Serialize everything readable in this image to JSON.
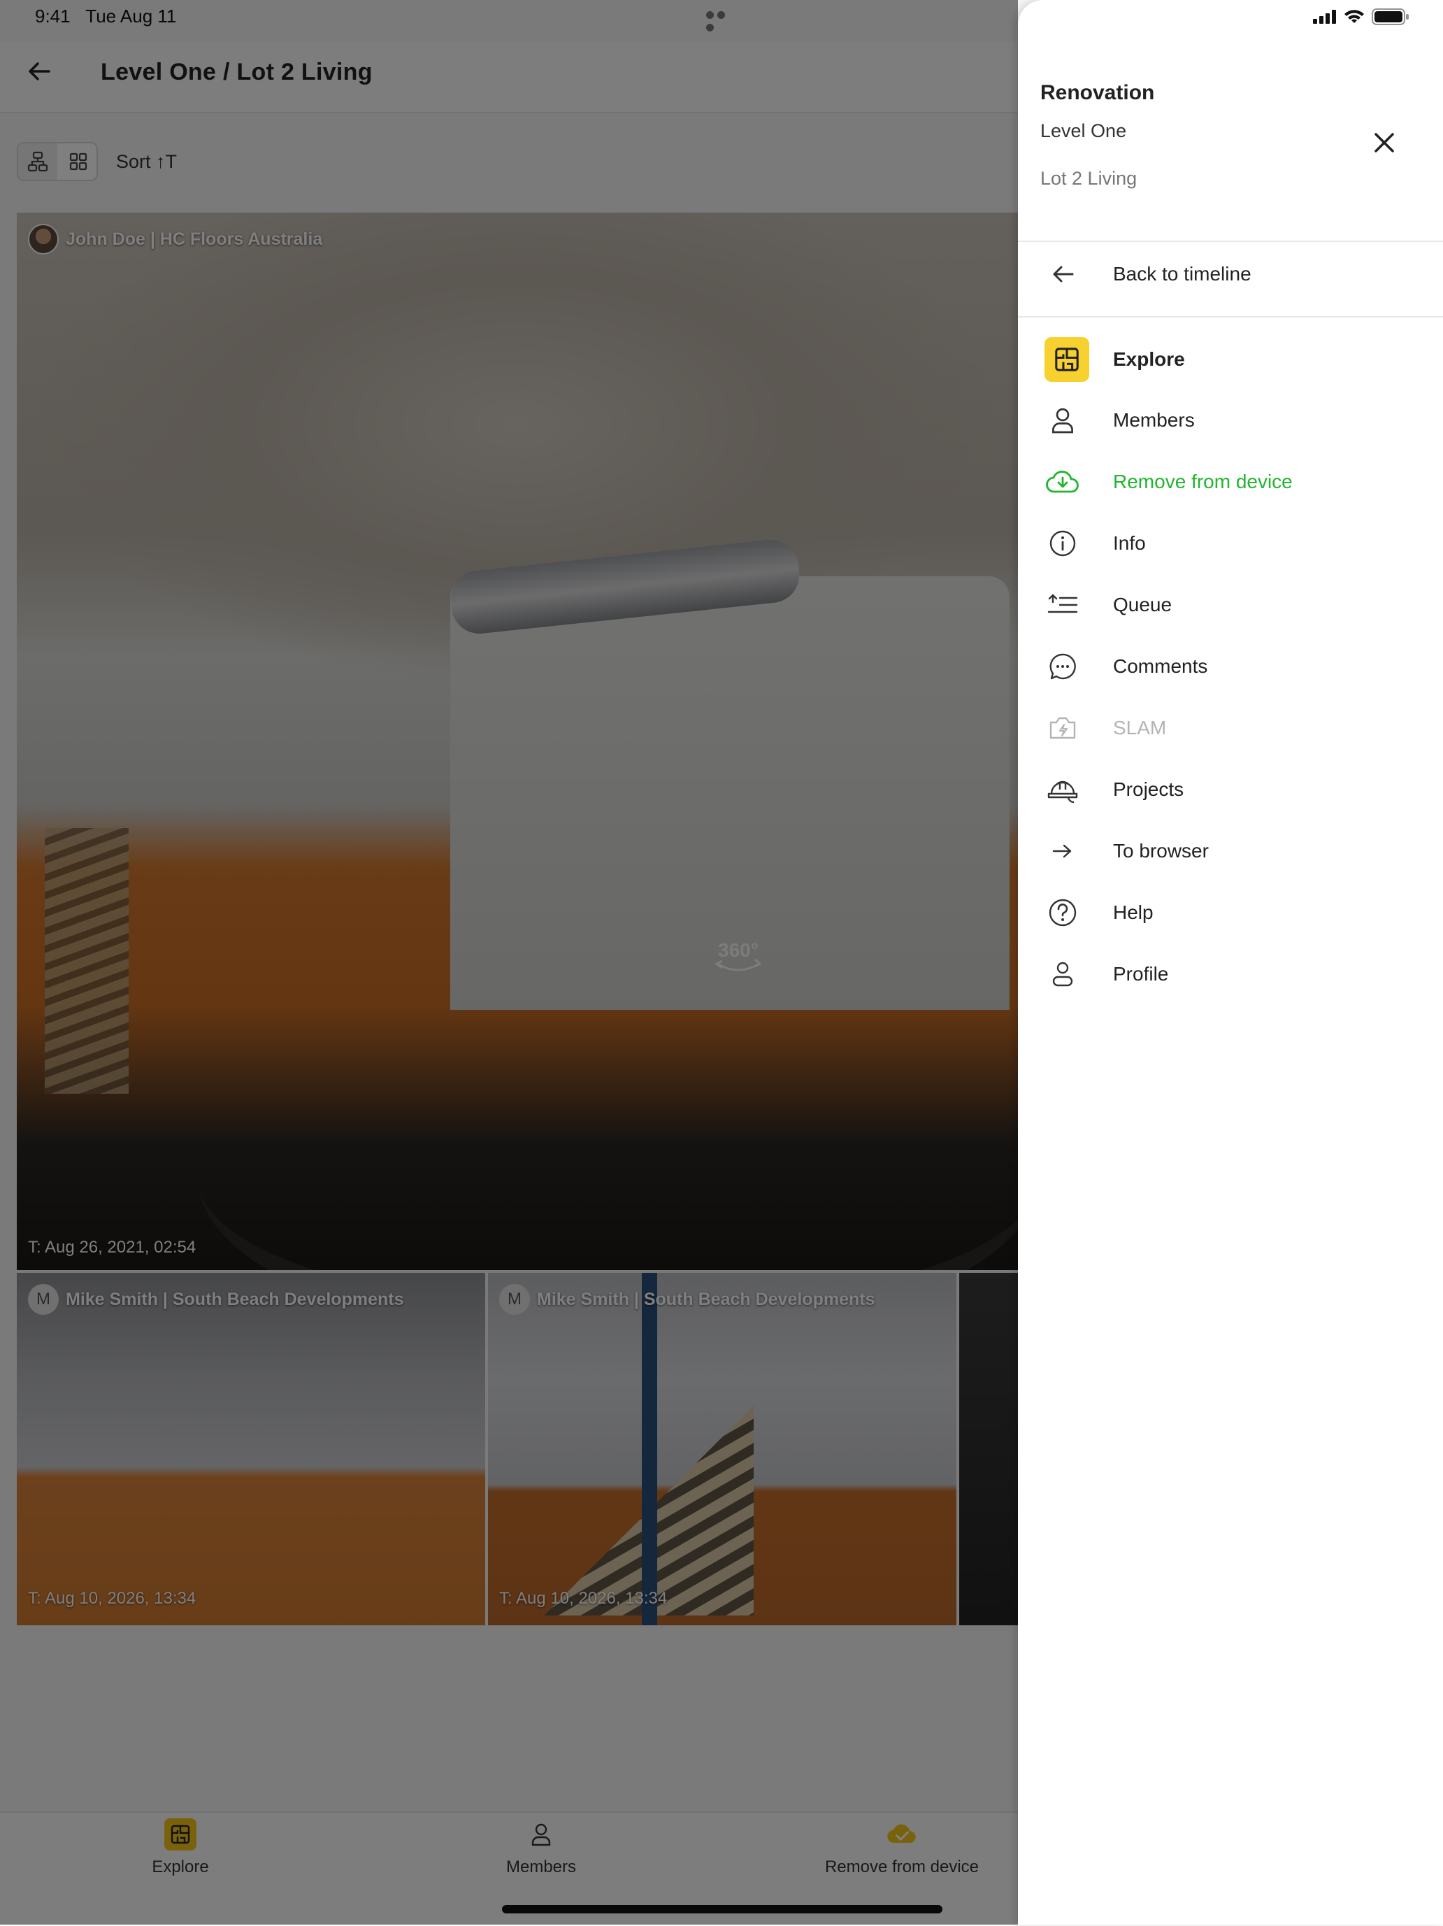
{
  "status": {
    "time": "9:41",
    "date": "Tue Aug 11"
  },
  "header": {
    "title": "Level One / Lot 2 Living"
  },
  "toolbar": {
    "sort_label": "Sort ↑T"
  },
  "photos": {
    "main": {
      "user": "John Doe | HC Floors Australia",
      "timestamp": "T: Aug 26, 2021, 02:54"
    },
    "a": {
      "avatar_letter": "M",
      "user": "Mike Smith | South Beach Developments",
      "timestamp": "T: Aug 10, 2026, 13:34"
    },
    "b": {
      "avatar_letter": "M",
      "user": "Mike Smith | South Beach Developments",
      "timestamp": "T: Aug 10, 2026, 13:34"
    }
  },
  "tabbar": {
    "explore": "Explore",
    "members": "Members",
    "remove": "Remove from device"
  },
  "drawer": {
    "project": "Renovation",
    "level": "Level One",
    "lot": "Lot 2 Living",
    "back": "Back to timeline",
    "items": [
      {
        "label": "Explore",
        "icon": "floorplan-icon"
      },
      {
        "label": "Members",
        "icon": "person-icon"
      },
      {
        "label": "Remove from device",
        "icon": "cloud-download-icon"
      },
      {
        "label": "Info",
        "icon": "info-icon"
      },
      {
        "label": "Queue",
        "icon": "queue-icon"
      },
      {
        "label": "Comments",
        "icon": "comment-icon"
      },
      {
        "label": "SLAM",
        "icon": "camera-bolt-icon"
      },
      {
        "label": "Projects",
        "icon": "hardhat-icon"
      },
      {
        "label": "To browser",
        "icon": "arrow-right-icon"
      },
      {
        "label": "Help",
        "icon": "help-icon"
      },
      {
        "label": "Profile",
        "icon": "profile-icon"
      }
    ]
  },
  "colors": {
    "accent_yellow": "#f5c518",
    "success_green": "#22b52e",
    "disabled_gray": "#b4b4b4"
  }
}
